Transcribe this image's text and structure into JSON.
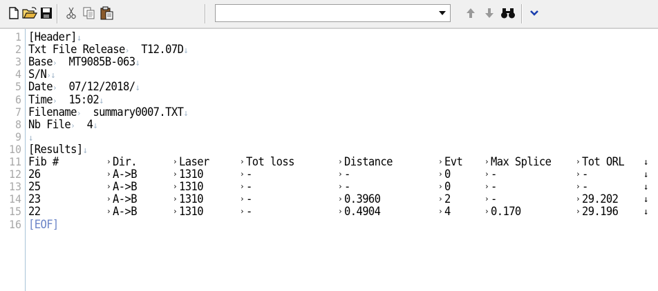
{
  "toolbar": {
    "search_value": "",
    "buttons": [
      "new-file-icon",
      "open-folder-icon",
      "save-disk-icon",
      "cut-icon",
      "copy-icon",
      "paste-icon",
      "arrow-up-icon",
      "arrow-down-icon",
      "binoculars-icon",
      "chevron-down-icon"
    ]
  },
  "symbols": {
    "tab": "›",
    "eol": "↓"
  },
  "lines": [
    {
      "n": "1",
      "text": "[Header]"
    },
    {
      "n": "2",
      "label": "Txt File Release",
      "value": "T12.07D"
    },
    {
      "n": "3",
      "label": "Base",
      "value": "MT9085B-063"
    },
    {
      "n": "4",
      "label": "S/N",
      "value": ""
    },
    {
      "n": "5",
      "label": "Date",
      "value": "07/12/2018/"
    },
    {
      "n": "6",
      "label": "Time",
      "value": "15:02"
    },
    {
      "n": "7",
      "label": "Filename",
      "value": "summary0007.TXT"
    },
    {
      "n": "8",
      "label": "Nb File",
      "value": "4"
    },
    {
      "n": "9",
      "text": ""
    },
    {
      "n": "10",
      "text": "[Results]"
    },
    {
      "n": "11",
      "cells": [
        "Fib #",
        "Dir.",
        "Laser",
        "Tot loss",
        "Distance",
        "Evt",
        "Max Splice",
        "Tot ORL"
      ]
    },
    {
      "n": "12",
      "cells": [
        "26",
        "A->B",
        "1310",
        "-",
        "-",
        "0",
        "-",
        "-"
      ]
    },
    {
      "n": "13",
      "cells": [
        "25",
        "A->B",
        "1310",
        "-",
        "-",
        "0",
        "-",
        "-"
      ]
    },
    {
      "n": "14",
      "cells": [
        "23",
        "A->B",
        "1310",
        "-",
        "0.3960",
        "2",
        "-",
        "29.202"
      ]
    },
    {
      "n": "15",
      "cells": [
        "22",
        "A->B",
        "1310",
        "-",
        "0.4904",
        "4",
        "0.170",
        "29.196"
      ]
    },
    {
      "n": "16",
      "text": "[EOF]"
    }
  ]
}
